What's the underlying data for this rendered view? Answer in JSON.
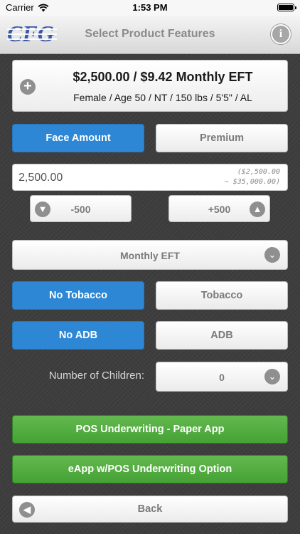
{
  "status_bar": {
    "carrier": "Carrier",
    "time": "1:53 PM"
  },
  "nav": {
    "logo_text": "CFG",
    "title": "Select Product Features",
    "info_glyph": "i"
  },
  "summary": {
    "headline": "$2,500.00 / $9.42 Monthly EFT",
    "details": "Female / Age 50 / NT / 150 lbs / 5'5\" / AL"
  },
  "mode_toggle": {
    "face_amount": "Face Amount",
    "premium": "Premium",
    "selected": "face_amount"
  },
  "amount": {
    "value": "2,500.00",
    "range_line1": "($2,500.00",
    "range_line2": "~ $35,000.00)"
  },
  "steppers": {
    "minus": "-500",
    "plus": "+500"
  },
  "payment_mode": {
    "selected": "Monthly EFT"
  },
  "tobacco": {
    "no": "No Tobacco",
    "yes": "Tobacco",
    "selected": "no"
  },
  "adb": {
    "no": "No ADB",
    "yes": "ADB",
    "selected": "no"
  },
  "children": {
    "label": "Number of Children:",
    "value": "0"
  },
  "actions": {
    "pos": "POS Underwriting - Paper App",
    "eapp": "eApp w/POS Underwriting Option",
    "back": "Back"
  },
  "colors": {
    "selected_blue": "#2d87d5",
    "action_green": "#4fab3d",
    "background": "#3d3d3d"
  },
  "icons": [
    "wifi-icon",
    "battery-icon",
    "info-icon",
    "plus-circle-icon",
    "arrow-down-circle-icon",
    "arrow-up-circle-icon",
    "chevron-down-icon",
    "arrow-left-circle-icon"
  ]
}
